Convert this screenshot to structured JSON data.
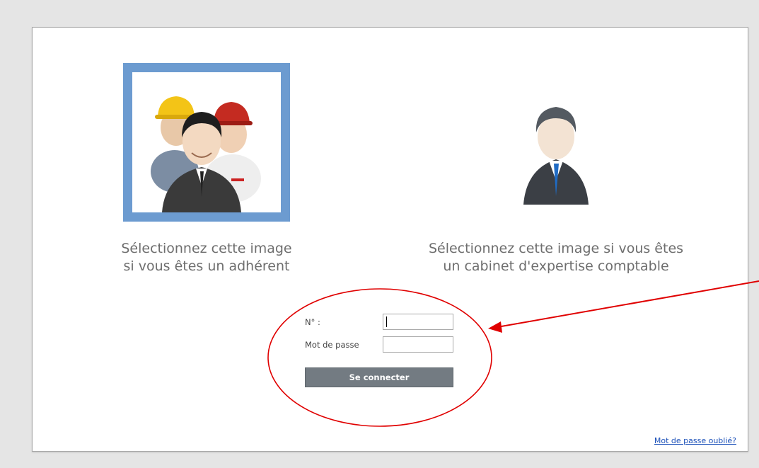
{
  "choices": {
    "member": {
      "caption": "Sélectionnez cette image\nsi vous êtes un adhérent",
      "selected": true
    },
    "accountant": {
      "caption": "Sélectionnez cette image si vous êtes\nun cabinet d'expertise comptable",
      "selected": false
    }
  },
  "login": {
    "number_label": "N° :",
    "number_value": "",
    "password_label": "Mot de passe",
    "password_value": "",
    "submit_label": "Se connecter"
  },
  "footer": {
    "forgot_password_link": "Mot de passe oublié?"
  },
  "colors": {
    "selection_border": "#6c9bd0",
    "button_bg": "#737b82",
    "annotation": "#e00000",
    "link": "#1a4fb8"
  },
  "icons": {
    "member": "group-of-workers-icon",
    "accountant": "businessman-icon"
  }
}
